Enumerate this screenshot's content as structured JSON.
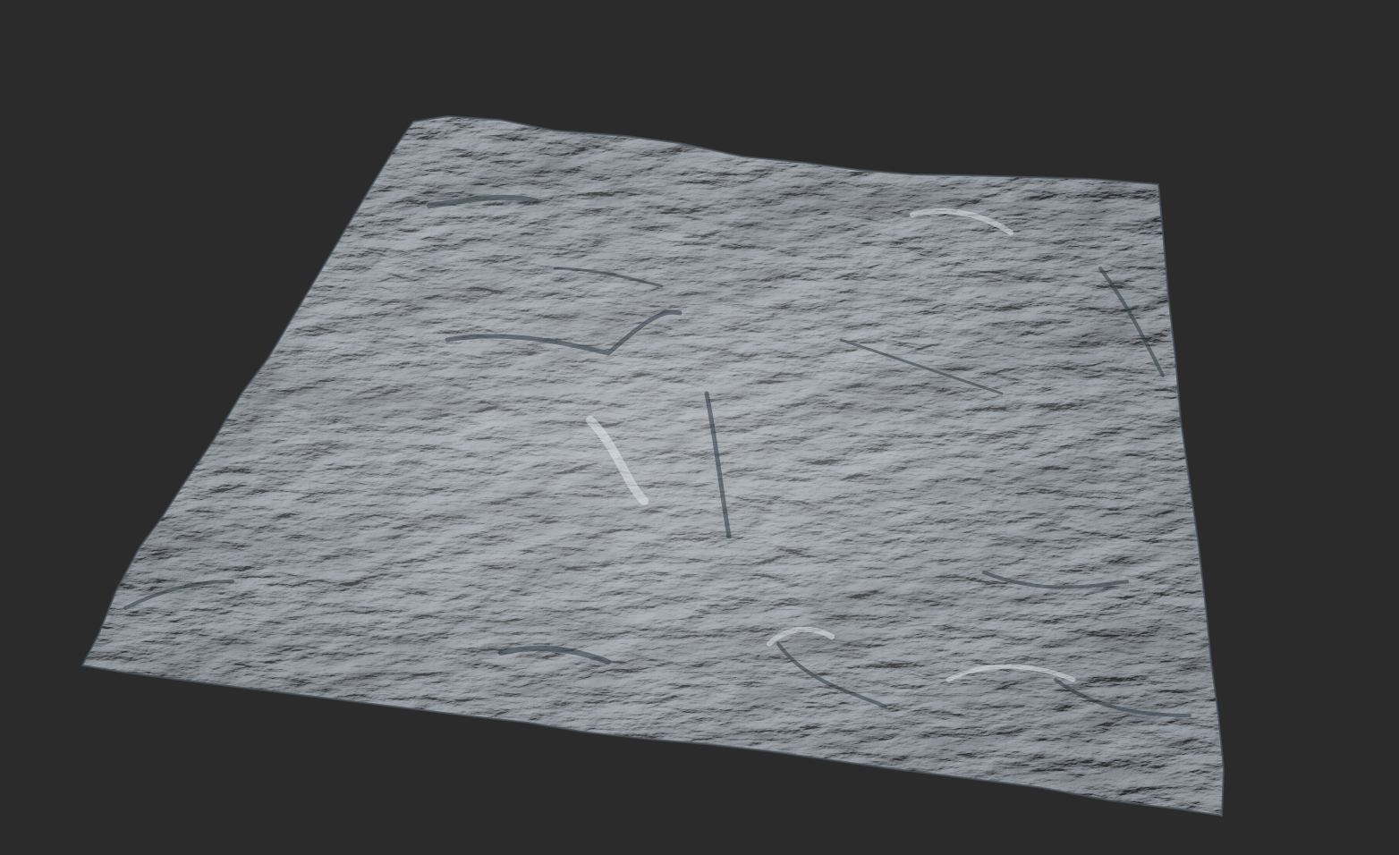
{
  "viewport": {
    "background_color": "#2b2b2b",
    "content": "terrain-heightfield-mesh"
  },
  "terrain": {
    "base_color": "#b9bec4",
    "highlight_color": "#e3e7ea",
    "shadow_color": "#2e3844",
    "edge_shadow_color": "#47505a"
  }
}
